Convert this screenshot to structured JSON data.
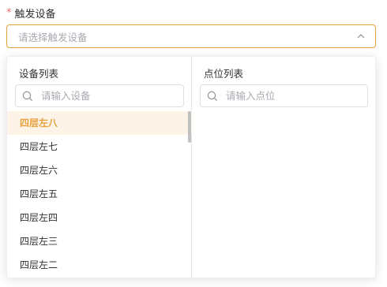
{
  "field": {
    "required_mark": "*",
    "label": "触发设备",
    "placeholder": "请选择触发设备"
  },
  "device_panel": {
    "title": "设备列表",
    "search_placeholder": "请输入设备",
    "items": [
      "四层左八",
      "四层左七",
      "四层左六",
      "四层左五",
      "四层左四",
      "四层左三",
      "四层左二"
    ],
    "selected_index": 0
  },
  "point_panel": {
    "title": "点位列表",
    "search_placeholder": "请输入点位"
  },
  "colors": {
    "accent": "#e6a23c",
    "selected_bg": "#fdf3e7",
    "required": "#f56c6c"
  }
}
